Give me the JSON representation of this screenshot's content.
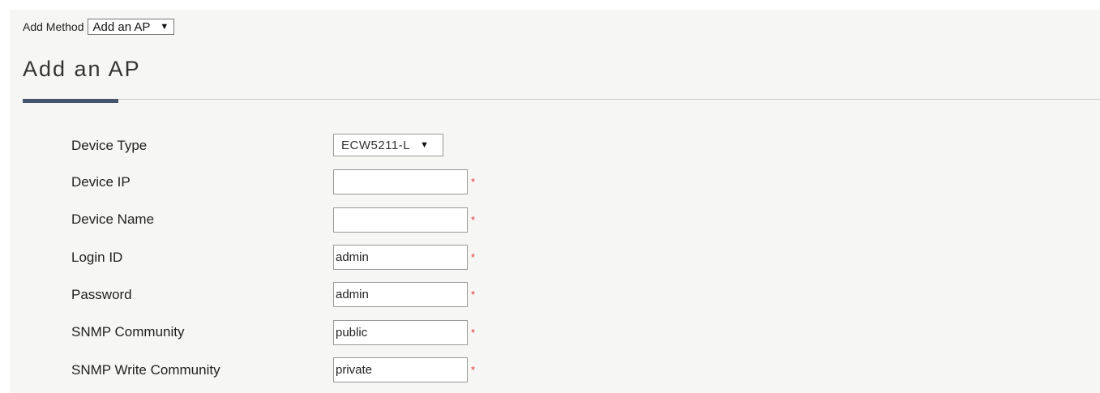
{
  "add_method": {
    "label": "Add Method",
    "selected": "Add an AP",
    "dropdown_arrow": "▼"
  },
  "page_title": "Add an AP",
  "required_marker": "*",
  "form": {
    "device_type": {
      "label": "Device Type",
      "value": "ECW5211-L",
      "dropdown_arrow": "▼"
    },
    "device_ip": {
      "label": "Device IP",
      "value": ""
    },
    "device_name": {
      "label": "Device Name",
      "value": ""
    },
    "login_id": {
      "label": "Login ID",
      "value": "admin"
    },
    "password": {
      "label": "Password",
      "value": "admin"
    },
    "snmp_community": {
      "label": "SNMP Community",
      "value": "public"
    },
    "snmp_write_community": {
      "label": "SNMP Write Community",
      "value": "private"
    }
  },
  "colors": {
    "accent": "#44566e",
    "required": "#e03a3a",
    "panel_background": "#f6f6f4"
  }
}
